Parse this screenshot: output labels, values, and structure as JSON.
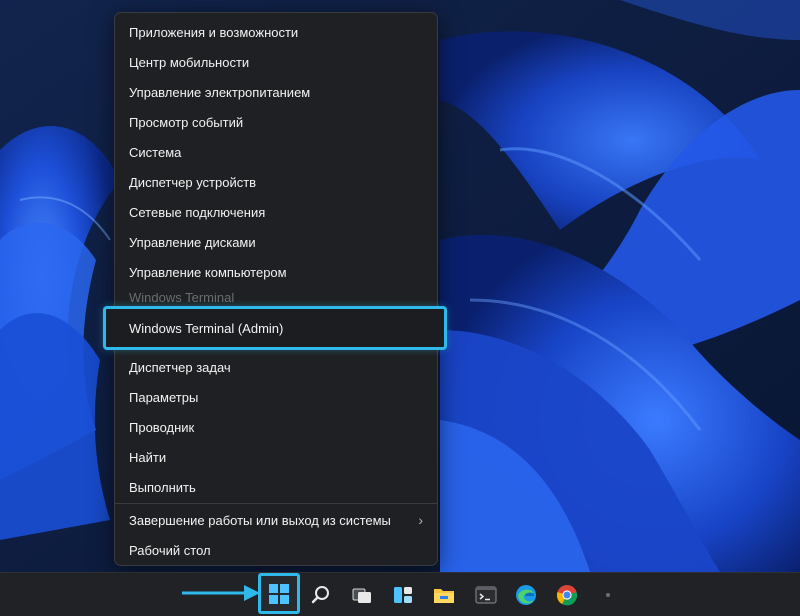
{
  "menu": {
    "items": [
      {
        "label": "Приложения и возможности"
      },
      {
        "label": "Центр мобильности"
      },
      {
        "label": "Управление электропитанием"
      },
      {
        "label": "Просмотр событий"
      },
      {
        "label": "Система"
      },
      {
        "label": "Диспетчер устройств"
      },
      {
        "label": "Сетевые подключения"
      },
      {
        "label": "Управление дисками"
      },
      {
        "label": "Управление компьютером"
      },
      {
        "label": "Windows Terminal"
      },
      {
        "label": "Windows Terminal (Admin)"
      },
      {
        "label": "Диспетчер задач"
      },
      {
        "label": "Параметры"
      },
      {
        "label": "Проводник"
      },
      {
        "label": "Найти"
      },
      {
        "label": "Выполнить"
      },
      {
        "label": "Завершение работы или выход из системы"
      },
      {
        "label": "Рабочий стол"
      }
    ]
  },
  "taskbar": {
    "icons": [
      "windows-start-icon",
      "search-icon",
      "task-view-icon",
      "widgets-icon",
      "file-explorer-icon",
      "terminal-icon",
      "edge-icon",
      "chrome-icon"
    ]
  },
  "colors": {
    "accent": "#2fb8ea",
    "menu_bg": "#1f2023",
    "taskbar_bg": "#202225",
    "wallpaper_blue": "#1a4fd6"
  }
}
